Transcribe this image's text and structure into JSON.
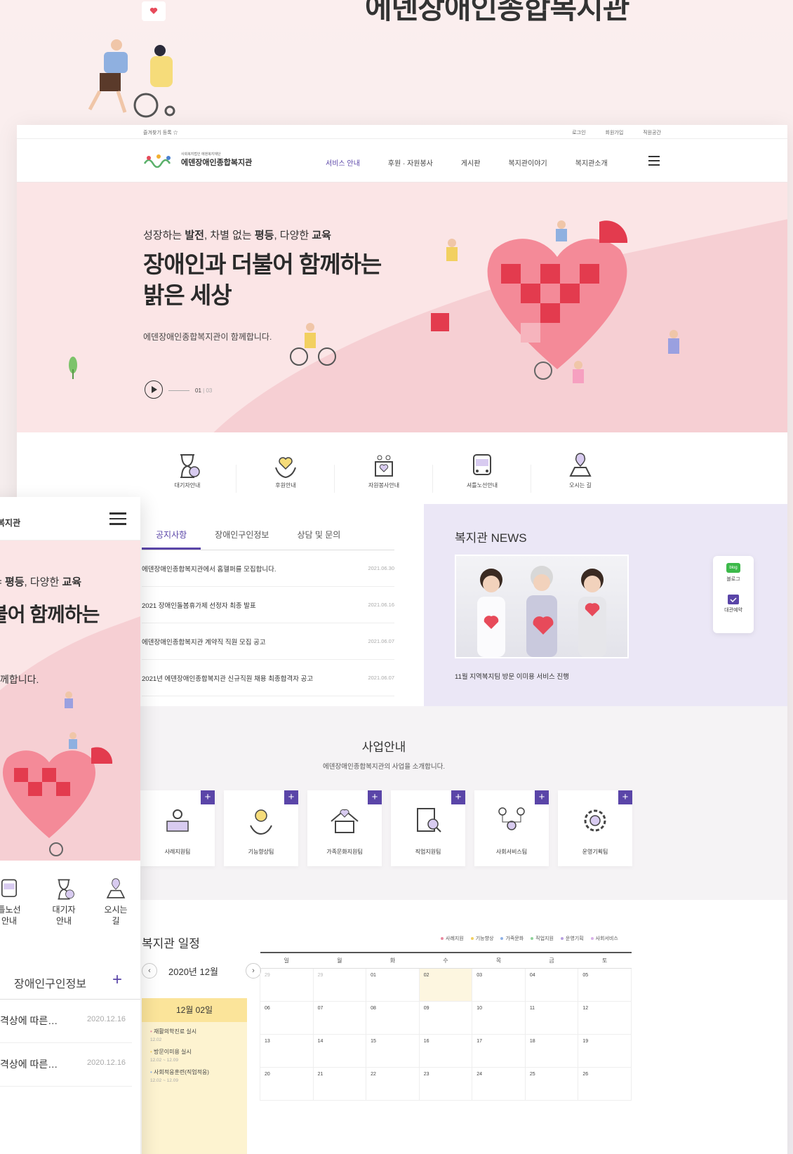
{
  "page": {
    "top_heading_cut": "에덴장애인종합복지관"
  },
  "util": {
    "bookmark": "즐겨찾기 등록 ☆",
    "links": [
      "로그인",
      "회원가입",
      "직원공간"
    ]
  },
  "logo": {
    "sub": "사회복지법인 에덴복지재단",
    "main": "에덴장애인종합복지관"
  },
  "gnb": {
    "menu": [
      "서비스 안내",
      "후원 · 자원봉사",
      "게시판",
      "복지관이야기",
      "복지관소개"
    ]
  },
  "hero": {
    "kicker_parts": [
      "성장하는 ",
      "발전",
      ", 차별 없는 ",
      "평등",
      ", 다양한 ",
      "교육"
    ],
    "title_line1": "장애인과 더불어 함께하는",
    "title_line2": "밝은 세상",
    "desc": "에덴장애인종합복지관이 함께합니다.",
    "pager_current": "01",
    "pager_total": "03"
  },
  "quick": [
    "대기자안내",
    "후원안내",
    "자원봉사안내",
    "셔틀노선안내",
    "오시는 길"
  ],
  "notice": {
    "tabs": [
      "공지사항",
      "장애인구인정보",
      "상담 및 문의"
    ],
    "rows": [
      {
        "title": "에덴장애인종합복지관에서 홈헬퍼를 모집합니다.",
        "date": "2021.06.30"
      },
      {
        "title": "2021 장애인돌봄휴가제 선정자 최종 발표",
        "date": "2021.06.16"
      },
      {
        "title": "에덴장애인종합복지관 계약직 직원 모집 공고",
        "date": "2021.06.07"
      },
      {
        "title": "2021년 에덴장애인종합복지관 신규직원 채용 최종합격자 공고",
        "date": "2021.06.07"
      }
    ]
  },
  "news": {
    "title": "복지관 NEWS",
    "caption": "11월 지역복지팀 방문 이미용 서비스 진행",
    "side": [
      "블로그",
      "대관예약"
    ],
    "blog_badge": "blog"
  },
  "biz": {
    "title": "사업안내",
    "desc": "에덴장애인종합복지관의 사업을 소개합니다.",
    "cards": [
      "사례지원팀",
      "기능향상팀",
      "가족문화지원팀",
      "직업지원팀",
      "사회서비스팀",
      "운영기획팀"
    ],
    "plus": "+"
  },
  "schedule": {
    "title": "복지관 일정",
    "legend": [
      {
        "label": "사례지원",
        "color": "#e88aa0"
      },
      {
        "label": "기능향상",
        "color": "#f2d060"
      },
      {
        "label": "가족문화",
        "color": "#8fb2e6"
      },
      {
        "label": "직업지원",
        "color": "#8fd39a"
      },
      {
        "label": "운영기획",
        "color": "#b79fe0"
      },
      {
        "label": "사회서비스",
        "color": "#d8b0e8"
      }
    ],
    "month": "2020년 12월",
    "prev": "‹",
    "next": "›",
    "day_title": "12월 02일",
    "events": [
      {
        "title": "재활의학진료 실시",
        "time": "12.02"
      },
      {
        "title": "방문이미용 실시",
        "time": "12.02 ~ 12.09"
      },
      {
        "title": "사회적응훈련(직업적응)",
        "time": "12.02 ~ 12.09"
      }
    ],
    "weekdays": [
      "일",
      "월",
      "화",
      "수",
      "목",
      "금",
      "토"
    ],
    "weeks": [
      [
        "29",
        "29",
        "01",
        "02",
        "03",
        "04",
        "05"
      ],
      [
        "06",
        "07",
        "08",
        "09",
        "10",
        "11",
        "12"
      ],
      [
        "13",
        "14",
        "15",
        "16",
        "17",
        "18",
        "19"
      ],
      [
        "20",
        "21",
        "22",
        "23",
        "24",
        "25",
        "26"
      ]
    ]
  },
  "mobile": {
    "logo": "복지관",
    "kicker_parts": [
      "= ",
      "평등",
      ", 다양한 ",
      "교육"
    ],
    "title": "불어 함께하는",
    "desc": "께합니다.",
    "quick": [
      {
        "line1": "틀노선",
        "line2": "안내"
      },
      {
        "line1": "대기자",
        "line2": "안내"
      },
      {
        "line1": "오시는",
        "line2": "길"
      }
    ],
    "tab": "장애인구인정보",
    "tab_plus": "+",
    "rows": [
      {
        "title": "격상에 따른…",
        "date": "2020.12.16"
      },
      {
        "title": "격상에 따른…",
        "date": "2020.12.16"
      }
    ]
  }
}
